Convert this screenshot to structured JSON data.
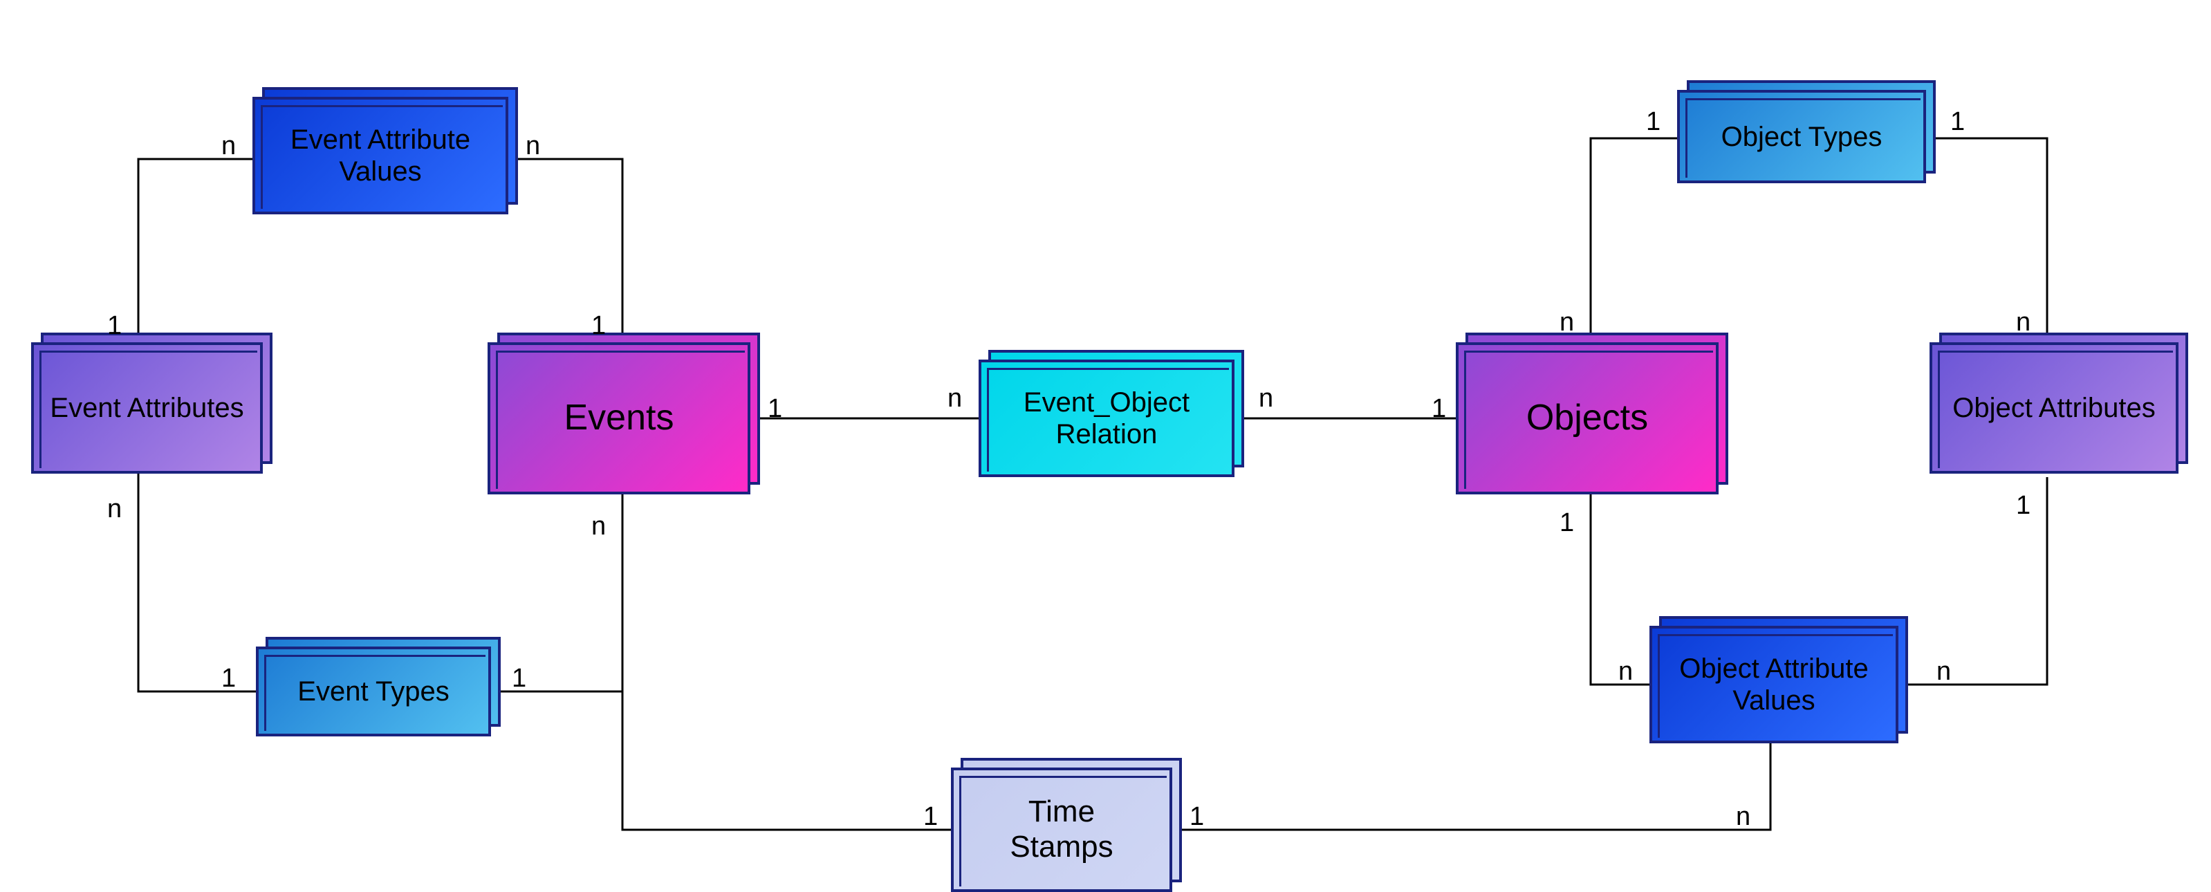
{
  "entities": {
    "event_attribute_values": {
      "label": "Event Attribute\nValues",
      "font_size": 40
    },
    "event_attributes": {
      "label": "Event Attributes",
      "font_size": 40
    },
    "event_types": {
      "label": "Event Types",
      "font_size": 40
    },
    "events": {
      "label": "Events",
      "font_size": 52
    },
    "event_object_relation": {
      "label": "Event_Object\nRelation",
      "font_size": 40
    },
    "time_stamps": {
      "label": "Time\nStamps",
      "font_size": 44
    },
    "objects": {
      "label": "Objects",
      "font_size": 52
    },
    "object_types": {
      "label": "Object Types",
      "font_size": 40
    },
    "object_attributes": {
      "label": "Object Attributes",
      "font_size": 40
    },
    "object_attribute_values": {
      "label": "Object Attribute\nValues",
      "font_size": 40
    }
  },
  "gradients": {
    "magenta": {
      "from": "#8a4bd6",
      "to": "#ff2bc8"
    },
    "blue": {
      "from": "#0b3bd6",
      "to": "#2d6cff"
    },
    "skyblue": {
      "from": "#1d7bd4",
      "to": "#52c0f0"
    },
    "purple": {
      "from": "#6a55d6",
      "to": "#b084e6"
    },
    "cyan": {
      "from": "#00d6ea",
      "to": "#24e3f2"
    },
    "lavender": {
      "from": "#c5cdf0",
      "to": "#cfd6f4"
    }
  },
  "cardinality_labels": {
    "one": "1",
    "many": "n"
  },
  "edges_comment": "cardinalities: 1 = one, n = many"
}
